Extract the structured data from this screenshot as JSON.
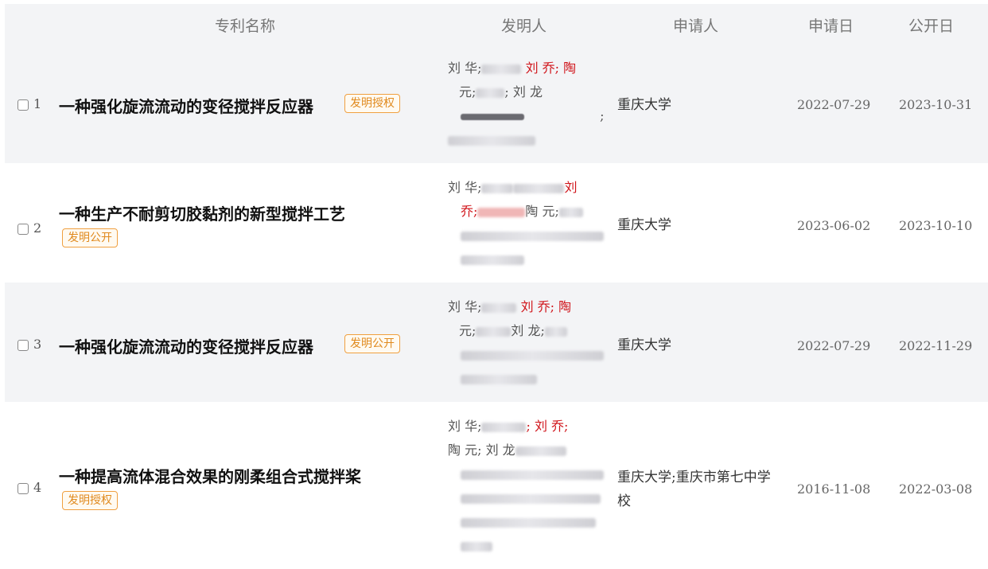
{
  "header": {
    "name": "专利名称",
    "inventor": "发明人",
    "applicant": "申请人",
    "apply_date": "申请日",
    "pub_date": "公开日"
  },
  "rows": [
    {
      "index": "1",
      "title": "一种强化旋流流动的变径搅拌反应器",
      "tag": "发明授权",
      "inventor_lines": [
        "刘 华;",
        "刘 乔; 陶",
        "元;",
        "; 刘 龙",
        ";"
      ],
      "applicant": "重庆大学",
      "apply_date": "2022-07-29",
      "pub_date": "2023-10-31"
    },
    {
      "index": "2",
      "title": "一种生产不耐剪切胶黏剂的新型搅拌工艺",
      "tag": "发明公开",
      "inventor_lines": [
        "刘 华;",
        "刘",
        "乔;",
        "陶 元;"
      ],
      "applicant": "重庆大学",
      "apply_date": "2023-06-02",
      "pub_date": "2023-10-10"
    },
    {
      "index": "3",
      "title": "一种强化旋流流动的变径搅拌反应器",
      "tag": "发明公开",
      "inventor_lines": [
        "刘 华;",
        "刘 乔; 陶",
        "元;",
        "刘 龙;"
      ],
      "applicant": "重庆大学",
      "apply_date": "2022-07-29",
      "pub_date": "2022-11-29"
    },
    {
      "index": "4",
      "title": "一种提高流体混合效果的刚柔组合式搅拌桨",
      "tag": "发明授权",
      "inventor_lines": [
        "刘 华;",
        "; 刘 乔;",
        "陶 元; 刘 龙"
      ],
      "applicant": "重庆大学;重庆市第七中学校",
      "apply_date": "2016-11-08",
      "pub_date": "2022-03-08"
    }
  ]
}
